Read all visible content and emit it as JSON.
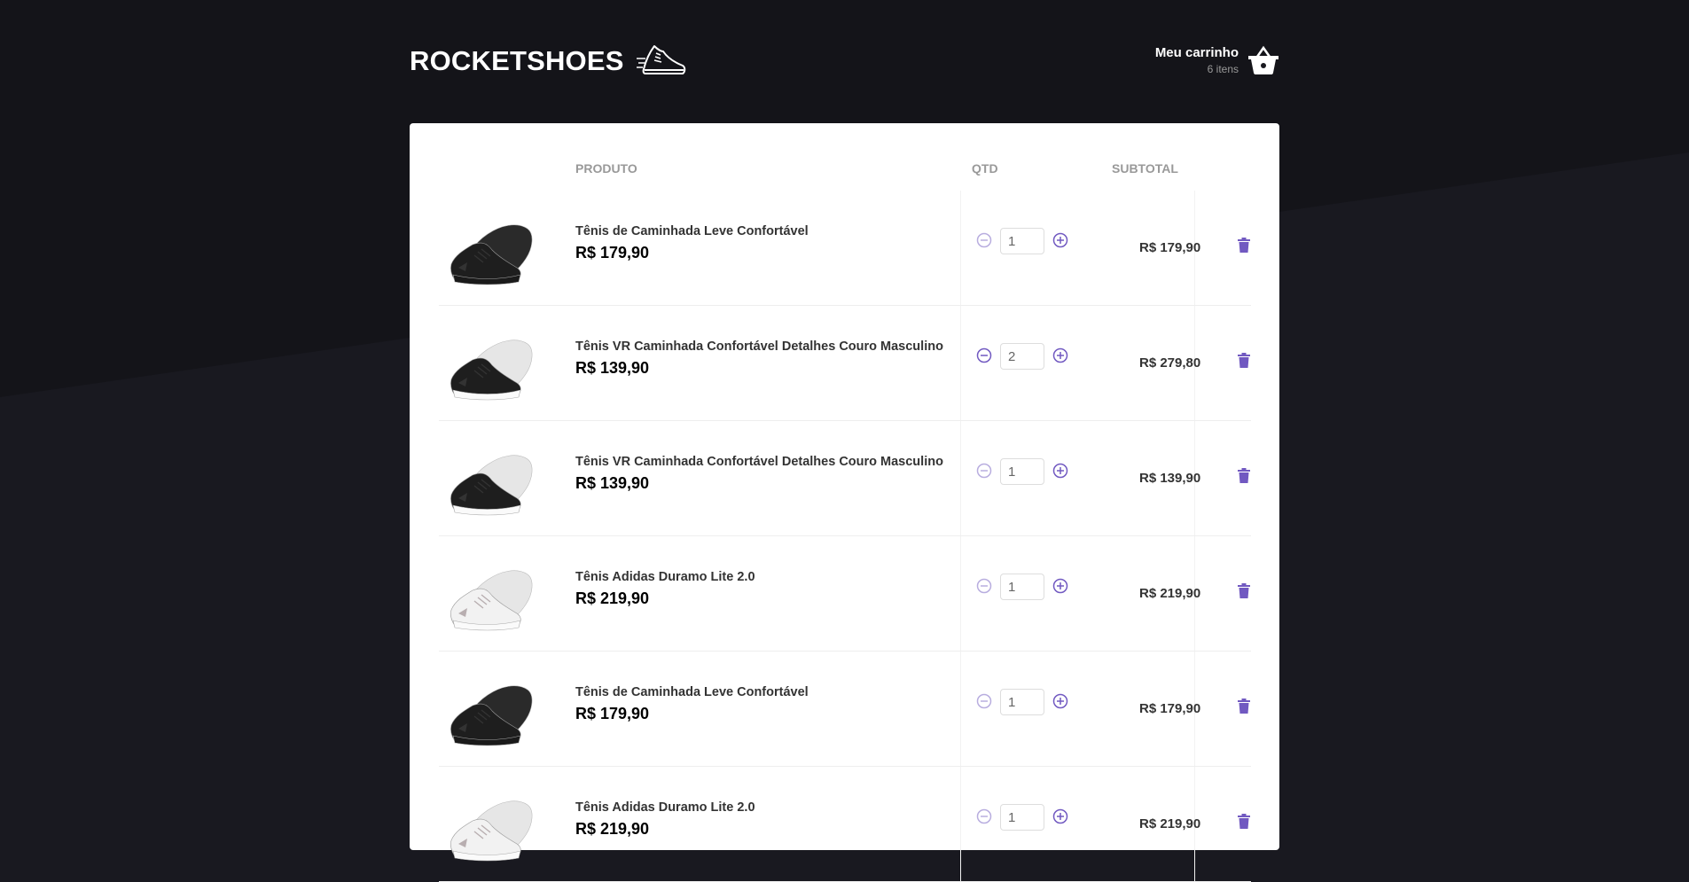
{
  "header": {
    "logo_text": "ROCKETSHOES",
    "cart_title": "Meu carrinho",
    "cart_count": "6 itens"
  },
  "table": {
    "col_product": "PRODUTO",
    "col_qty": "QTD",
    "col_subtotal": "SUBTOTAL"
  },
  "colors": {
    "accent": "#7159c1",
    "background": "#191920",
    "panel": "#ffffff"
  },
  "items": [
    {
      "name": "Tênis de Caminhada Leve Confortável",
      "price": "R$ 179,90",
      "qty": "1",
      "subtotal": "R$ 179,90",
      "shoe": "black",
      "minus_enabled": false
    },
    {
      "name": "Tênis VR Caminhada Confortável Detalhes Couro Masculino",
      "price": "R$ 139,90",
      "qty": "2",
      "subtotal": "R$ 279,80",
      "shoe": "black-white",
      "minus_enabled": true
    },
    {
      "name": "Tênis VR Caminhada Confortável Detalhes Couro Masculino",
      "price": "R$ 139,90",
      "qty": "1",
      "subtotal": "R$ 139,90",
      "shoe": "black-white",
      "minus_enabled": false
    },
    {
      "name": "Tênis Adidas Duramo Lite 2.0",
      "price": "R$ 219,90",
      "qty": "1",
      "subtotal": "R$ 219,90",
      "shoe": "white",
      "minus_enabled": false
    },
    {
      "name": "Tênis de Caminhada Leve Confortável",
      "price": "R$ 179,90",
      "qty": "1",
      "subtotal": "R$ 179,90",
      "shoe": "black",
      "minus_enabled": false
    },
    {
      "name": "Tênis Adidas Duramo Lite 2.0",
      "price": "R$ 219,90",
      "qty": "1",
      "subtotal": "R$ 219,90",
      "shoe": "white",
      "minus_enabled": false
    }
  ]
}
